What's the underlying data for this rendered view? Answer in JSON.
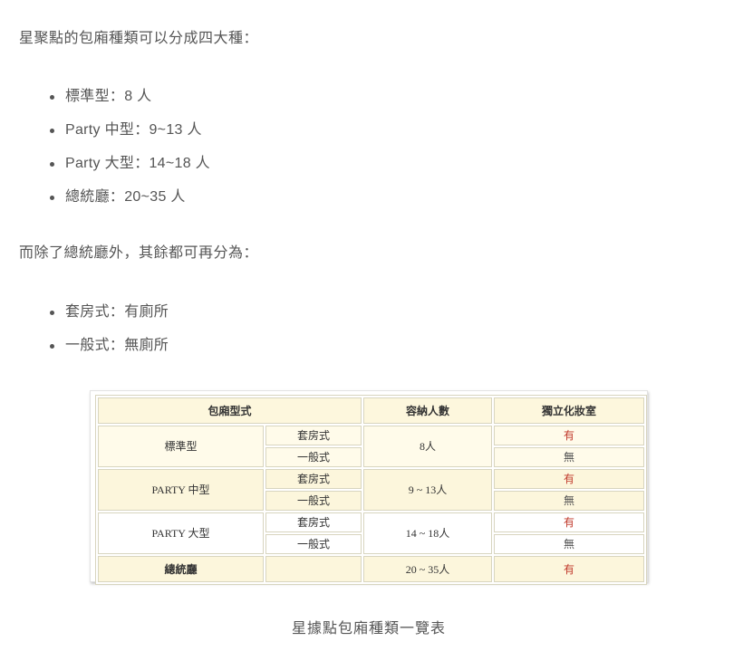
{
  "intro_text": "星聚點的包廂種類可以分成四大種：",
  "room_types": [
    {
      "label": "標準型：8 人"
    },
    {
      "label": "Party 中型：9~13 人"
    },
    {
      "label": "Party 大型：14~18 人"
    },
    {
      "label": "總統廳：20~35 人"
    }
  ],
  "sub_text": "而除了總統廳外，其餘都可再分為：",
  "sub_types": [
    {
      "label": "套房式：有廁所"
    },
    {
      "label": "一般式：無廁所"
    }
  ],
  "table": {
    "headers": {
      "type": "包廂型式",
      "capacity": "容納人數",
      "vanity": "獨立化妝室"
    },
    "rows": [
      {
        "type": "標準型",
        "capacity": "8人",
        "subs": [
          {
            "sub": "套房式",
            "vanity": "有"
          },
          {
            "sub": "一般式",
            "vanity": "無"
          }
        ]
      },
      {
        "type": "PARTY 中型",
        "capacity": "9 ~ 13人",
        "subs": [
          {
            "sub": "套房式",
            "vanity": "有"
          },
          {
            "sub": "一般式",
            "vanity": "無"
          }
        ]
      },
      {
        "type": "PARTY 大型",
        "capacity": "14 ~ 18人",
        "subs": [
          {
            "sub": "套房式",
            "vanity": "有"
          },
          {
            "sub": "一般式",
            "vanity": "無"
          }
        ]
      }
    ],
    "total_row": {
      "type": "總統廳",
      "sub": "",
      "capacity": "20 ~ 35人",
      "vanity": "有"
    }
  },
  "caption": "星據點包廂種類一覽表",
  "colors": {
    "text": "#555555",
    "yes_red": "#c0392b",
    "header_bg": "#fdf7dd",
    "cream_bg": "#fffbea",
    "border": "#d8d5bf"
  }
}
